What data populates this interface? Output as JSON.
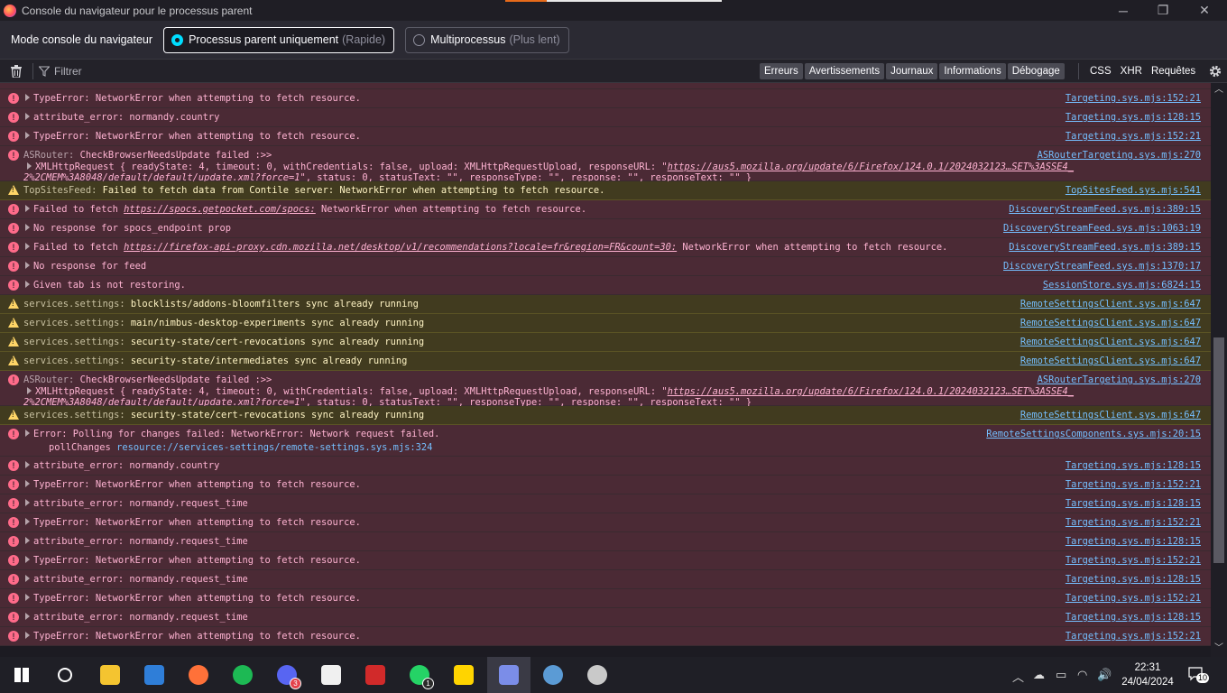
{
  "window": {
    "title": "Console du navigateur pour le processus parent",
    "controls": [
      "─",
      "❐",
      "✕"
    ]
  },
  "modebar": {
    "label": "Mode console du navigateur",
    "parent_only": {
      "label": "Processus parent uniquement",
      "hint": "(Rapide)",
      "selected": true
    },
    "multi": {
      "label": "Multiprocessus",
      "hint": "(Plus lent)",
      "selected": false
    }
  },
  "toolbar": {
    "filter_placeholder": "Filtrer",
    "levels": [
      "Erreurs",
      "Avertissements",
      "Journaux",
      "Informations",
      "Débogage"
    ],
    "requests": [
      "CSS",
      "XHR",
      "Requêtes"
    ]
  },
  "rows": [
    {
      "type": "err",
      "msg": "TypeError: NetworkError when attempting to fetch resource.",
      "src": "Targeting.sys.mjs:152:21"
    },
    {
      "type": "err",
      "msg": "attribute_error: normandy.country",
      "src": "Targeting.sys.mjs:128:15"
    },
    {
      "type": "err",
      "msg": "TypeError: NetworkError when attempting to fetch resource.",
      "src": "Targeting.sys.mjs:152:21"
    },
    {
      "type": "err3",
      "prefix": "ASRouter:",
      "msg": "CheckBrowserNeedsUpdate failed :>>",
      "xhr_line1": "XMLHttpRequest { readyState: 4, timeout: 0, withCredentials: false, upload: XMLHttpRequestUpload, responseURL: \"",
      "xhr_url1": "https://aus5.mozilla.org/update/6/Firefox/124.0.1/2024032123…SET%3ASSE4_",
      "xhr_url2": "2%2CMEM%3A8048/default/default/update.xml?force=1",
      "xhr_line2": "\", status: 0, statusText: \"\", responseType: \"\", response: \"\", responseText: \"\" }",
      "src": "ASRouterTargeting.sys.mjs:270"
    },
    {
      "type": "warn",
      "prefix": "TopSitesFeed:",
      "msg": "Failed to fetch data from Contile server: NetworkError when attempting to fetch resource.",
      "src": "TopSitesFeed.sys.mjs:541"
    },
    {
      "type": "errlink",
      "msg_before": "Failed to fetch ",
      "link": "https://spocs.getpocket.com/spocs:",
      "msg_after": " NetworkError when attempting to fetch resource.",
      "src": "DiscoveryStreamFeed.sys.mjs:389:15"
    },
    {
      "type": "err",
      "msg": "No response for spocs_endpoint prop",
      "src": "DiscoveryStreamFeed.sys.mjs:1063:19"
    },
    {
      "type": "errlink",
      "msg_before": "Failed to fetch ",
      "link": "https://firefox-api-proxy.cdn.mozilla.net/desktop/v1/recommendations?locale=fr&region=FR&count=30:",
      "msg_after": " NetworkError when attempting to fetch resource.",
      "src": "DiscoveryStreamFeed.sys.mjs:389:15"
    },
    {
      "type": "err",
      "msg": "No response for feed",
      "src": "DiscoveryStreamFeed.sys.mjs:1370:17"
    },
    {
      "type": "err",
      "msg": "Given tab is not restoring.",
      "src": "SessionStore.sys.mjs:6824:15"
    },
    {
      "type": "warn",
      "prefix": "services.settings:",
      "msg": "blocklists/addons-bloomfilters sync already running",
      "src": "RemoteSettingsClient.sys.mjs:647"
    },
    {
      "type": "warn",
      "prefix": "services.settings:",
      "msg": "main/nimbus-desktop-experiments sync already running",
      "src": "RemoteSettingsClient.sys.mjs:647"
    },
    {
      "type": "warn",
      "prefix": "services.settings:",
      "msg": "security-state/cert-revocations sync already running",
      "src": "RemoteSettingsClient.sys.mjs:647"
    },
    {
      "type": "warn",
      "prefix": "services.settings:",
      "msg": "security-state/intermediates sync already running",
      "src": "RemoteSettingsClient.sys.mjs:647"
    },
    {
      "type": "err3",
      "prefix": "ASRouter:",
      "msg": "CheckBrowserNeedsUpdate failed :>>",
      "xhr_line1": "XMLHttpRequest { readyState: 4, timeout: 0, withCredentials: false, upload: XMLHttpRequestUpload, responseURL: \"",
      "xhr_url1": "https://aus5.mozilla.org/update/6/Firefox/124.0.1/2024032123…SET%3ASSE4_",
      "xhr_url2": "2%2CMEM%3A8048/default/default/update.xml?force=1",
      "xhr_line2": "\", status: 0, statusText: \"\", responseType: \"\", response: \"\", responseText: \"\" }",
      "src": "ASRouterTargeting.sys.mjs:270"
    },
    {
      "type": "warn",
      "prefix": "services.settings:",
      "msg": "security-state/cert-revocations sync already running",
      "src": "RemoteSettingsClient.sys.mjs:647"
    },
    {
      "type": "err2",
      "msg": "Error: Polling for changes failed: NetworkError: Network request failed.",
      "stack_fn": "pollChanges",
      "stack_src": "resource://services-settings/remote-settings.sys.mjs:324",
      "src": "RemoteSettingsComponents.sys.mjs:20:15"
    },
    {
      "type": "err",
      "msg": "attribute_error: normandy.country",
      "src": "Targeting.sys.mjs:128:15",
      "noarrow": true
    },
    {
      "type": "err",
      "msg": "TypeError: NetworkError when attempting to fetch resource.",
      "src": "Targeting.sys.mjs:152:21"
    },
    {
      "type": "err",
      "msg": "attribute_error: normandy.request_time",
      "src": "Targeting.sys.mjs:128:15",
      "noarrow": true
    },
    {
      "type": "err",
      "msg": "TypeError: NetworkError when attempting to fetch resource.",
      "src": "Targeting.sys.mjs:152:21"
    },
    {
      "type": "err",
      "msg": "attribute_error: normandy.request_time",
      "src": "Targeting.sys.mjs:128:15",
      "noarrow": true
    },
    {
      "type": "err",
      "msg": "TypeError: NetworkError when attempting to fetch resource.",
      "src": "Targeting.sys.mjs:152:21"
    },
    {
      "type": "err",
      "msg": "attribute_error: normandy.request_time",
      "src": "Targeting.sys.mjs:128:15",
      "noarrow": true
    },
    {
      "type": "err",
      "msg": "TypeError: NetworkError when attempting to fetch resource.",
      "src": "Targeting.sys.mjs:152:21"
    },
    {
      "type": "err",
      "msg": "attribute_error: normandy.request_time",
      "src": "Targeting.sys.mjs:128:15",
      "noarrow": true
    },
    {
      "type": "err",
      "msg": "TypeError: NetworkError when attempting to fetch resource.",
      "src": "Targeting.sys.mjs:152:21"
    }
  ],
  "taskbar": {
    "apps": [
      {
        "name": "windows-start",
        "color": "#ffffff"
      },
      {
        "name": "search",
        "color": "#ffffff"
      },
      {
        "name": "file-explorer",
        "color": "#f4c430"
      },
      {
        "name": "mail",
        "color": "#2f7ed8"
      },
      {
        "name": "firefox",
        "color": "#ff7139"
      },
      {
        "name": "spotify",
        "color": "#1db954"
      },
      {
        "name": "discord",
        "color": "#5865f2",
        "badge": "3"
      },
      {
        "name": "notepad",
        "color": "#f0f0f0"
      },
      {
        "name": "winrar",
        "color": "#d12a2a"
      },
      {
        "name": "whatsapp",
        "color": "#25d366",
        "badge": "1"
      },
      {
        "name": "sticky-notes",
        "color": "#ffd400"
      },
      {
        "name": "firefox-devtools",
        "color": "#7b8de8",
        "active": true
      },
      {
        "name": "network-app",
        "color": "#5b9bd5"
      },
      {
        "name": "clock-app",
        "color": "#c9c9c9"
      }
    ],
    "time": "22:31",
    "date": "24/04/2024",
    "notifications": "10"
  }
}
